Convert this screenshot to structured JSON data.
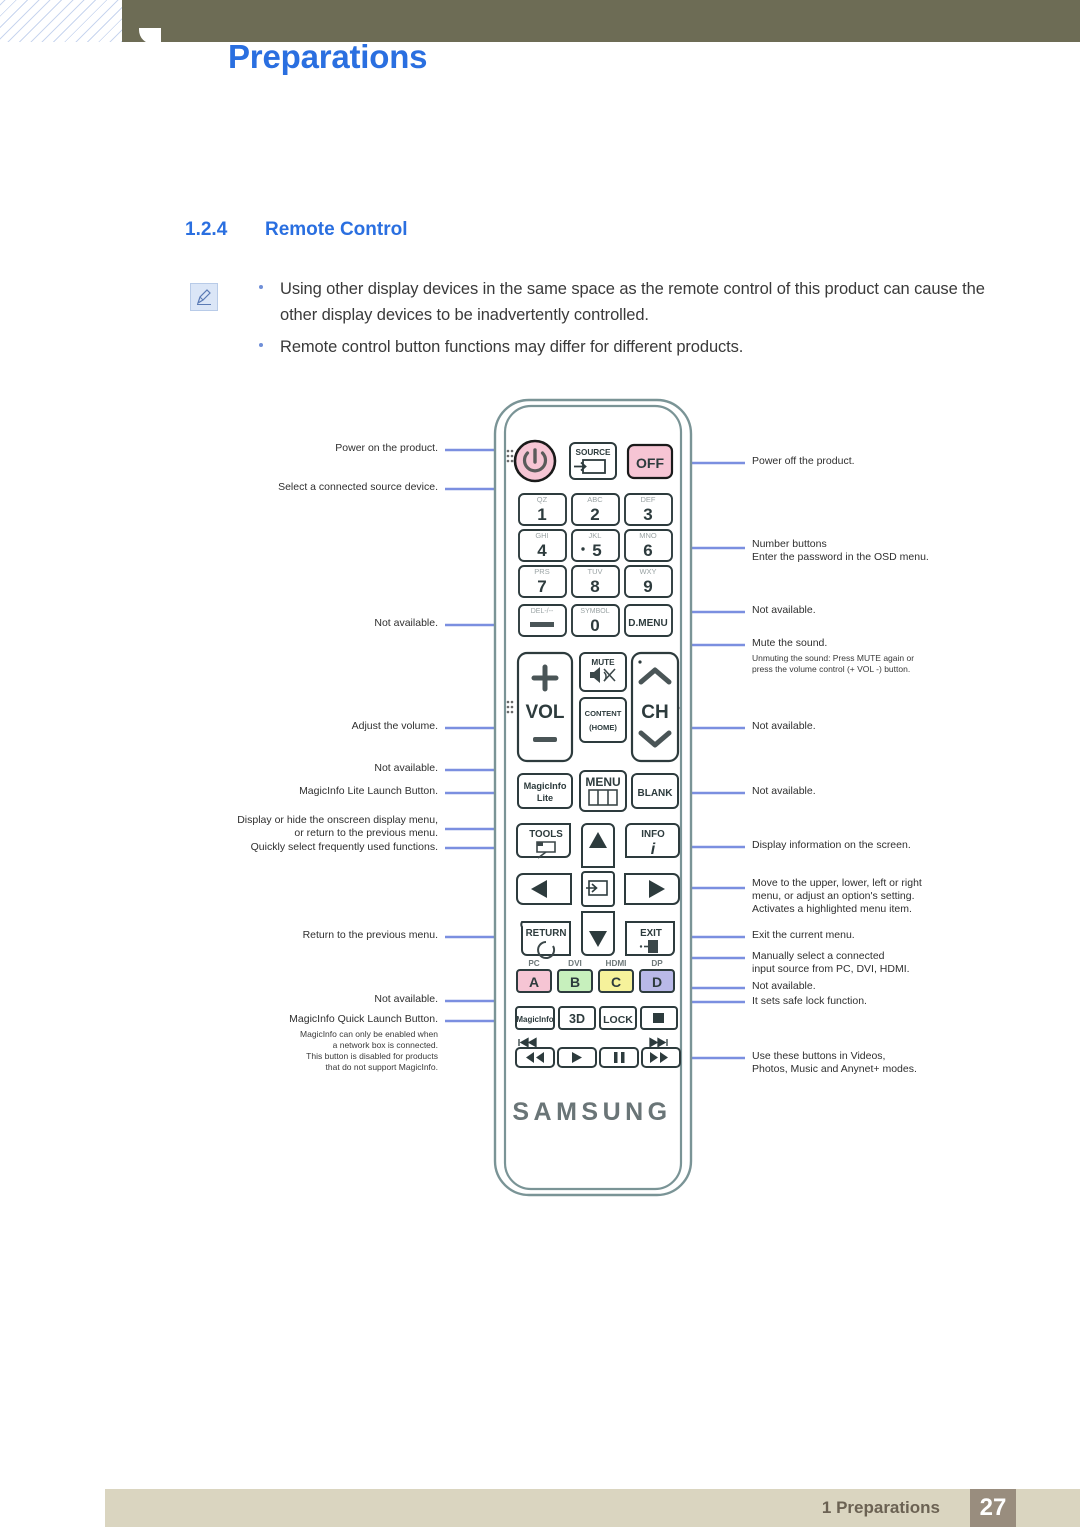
{
  "header": {
    "title": "Preparations"
  },
  "section": {
    "number": "1.2.4",
    "title": "Remote Control"
  },
  "note": {
    "icon": "note-pencil-icon",
    "items": [
      "Using other display devices in the same space as the remote control of this product can cause the other display devices to be inadvertently controlled.",
      "Remote control button functions may differ for different products."
    ]
  },
  "remote": {
    "brand": "SAMSUNG",
    "buttons": {
      "power": "power-icon",
      "source_label": "SOURCE",
      "off": "OFF",
      "num1": "1",
      "num1_sub": "QZ",
      "num2": "2",
      "num2_sub": "ABC",
      "num3": "3",
      "num3_sub": "DEF",
      "num4": "4",
      "num4_sub": "GHI",
      "num5": "5",
      "num5_sub": "JKL",
      "num6": "6",
      "num6_sub": "MNO",
      "num7": "7",
      "num7_sub": "PRS",
      "num8": "8",
      "num8_sub": "TUV",
      "num9": "9",
      "num9_sub": "WXY",
      "num0": "0",
      "num0_sub": "SYMBOL",
      "del_sub": "DEL-/--",
      "dmenu": "D.MENU",
      "vol": "VOL",
      "mute": "MUTE",
      "content_home_1": "CONTENT",
      "content_home_2": "(HOME)",
      "ch": "CH",
      "magicinfo_lite_1": "MagicInfo",
      "magicinfo_lite_2": "Lite",
      "menu": "MENU",
      "blank": "BLANK",
      "tools": "TOOLS",
      "info": "INFO",
      "info_glyph": "i",
      "return": "RETURN",
      "exit": "EXIT",
      "color_a": "A",
      "color_a_sub": "PC",
      "color_b": "B",
      "color_b_sub": "DVI",
      "color_c": "C",
      "color_c_sub": "HDMI",
      "color_d": "D",
      "color_d_sub": "DP",
      "magicinfo": "MagicInfo",
      "threed": "3D",
      "lock": "LOCK",
      "stop": "stop-icon",
      "prev_track": "prev-track-icon",
      "next_track": "next-track-icon",
      "rewind": "rewind-icon",
      "play": "play-icon",
      "pause": "pause-icon",
      "fastforward": "fast-forward-icon"
    },
    "colors": {
      "pink": "#f6c5d4",
      "green": "#c7f0bd",
      "yellow": "#f6f29b",
      "purple": "#b9b9e8",
      "body_outline": "#7a9496",
      "callout": "#7b8fe0"
    }
  },
  "callouts": {
    "left": [
      "Power on the product.",
      "Select a connected source device.",
      "Not available.",
      "Adjust the volume.",
      "Not available.",
      "MagicInfo Lite Launch Button.",
      "Display or hide the onscreen display menu,\nor return to the previous menu.",
      "Quickly select frequently used functions.",
      "Return to the previous menu.",
      "Not available.",
      "MagicInfo Quick Launch Button.",
      "MagicInfo can only be enabled when\na network box is connected.\nThis button is disabled for products\nthat do not support MagicInfo."
    ],
    "right": [
      "Power off the product.",
      "Number buttons\nEnter the password in the OSD menu.",
      "Not available.",
      "Mute the sound.",
      "Unmuting the sound: Press MUTE again or\npress the volume control (+  VOL  -) button.",
      "Not available.",
      "Not available.",
      "Display information on the screen.",
      "Move to the upper, lower, left or right\nmenu, or adjust an option's setting.\nActivates a highlighted menu item.",
      "Exit the current menu.",
      "Manually select a connected\ninput source from PC, DVI, HDMI.",
      "Not available.",
      "It sets safe lock function.",
      "Use these buttons in Videos,\nPhotos, Music and Anynet+ modes."
    ]
  },
  "footer": {
    "text": "1 Preparations",
    "page": "27"
  }
}
